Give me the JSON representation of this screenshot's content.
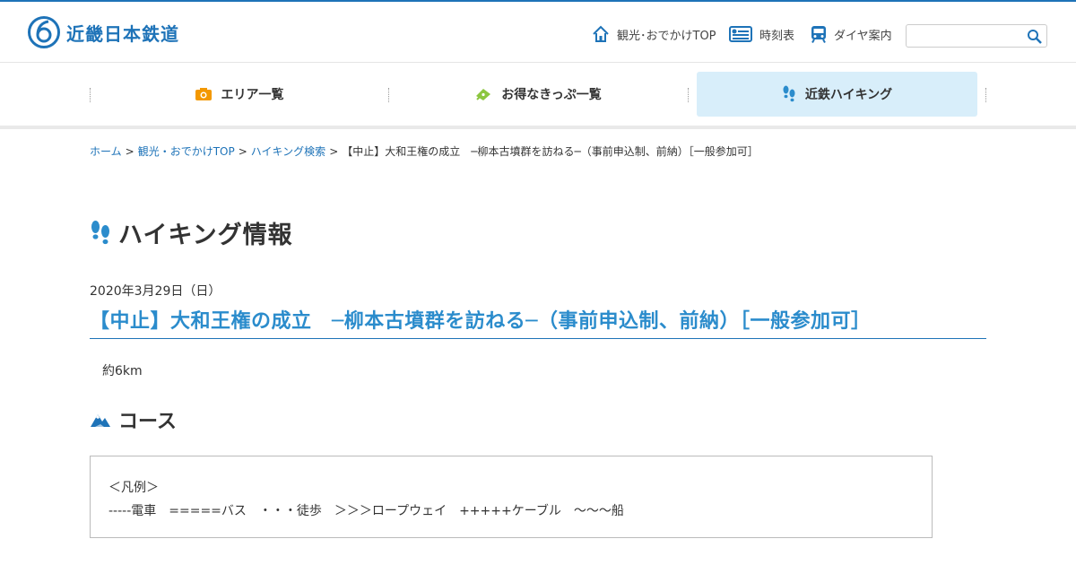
{
  "brand": {
    "name": "近畿日本鉄道",
    "color": "#1e73b8"
  },
  "header_links": [
    {
      "label": "観光･おでかけTOP",
      "icon": "home-icon"
    },
    {
      "label": "時刻表",
      "icon": "timetable-icon"
    },
    {
      "label": "ダイヤ案内",
      "icon": "train-icon"
    }
  ],
  "search": {
    "value": "",
    "placeholder": "",
    "icon": "search-icon"
  },
  "nav": [
    {
      "label": "エリア一覧",
      "icon": "camera-icon",
      "color": "#f39800"
    },
    {
      "label": "お得なきっぷ一覧",
      "icon": "ticket-icon",
      "color": "#8cc63f"
    },
    {
      "label": "近鉄ハイキング",
      "icon": "footprints-icon",
      "color": "#2b8ccc",
      "active": true
    }
  ],
  "breadcrumb": [
    "ホーム",
    "観光・おでかけTOP",
    "ハイキング検索",
    "【中止】大和王権の成立　─柳本古墳群を訪ねる─（事前申込制、前納）［一般参加可］"
  ],
  "page_title": "ハイキング情報",
  "event": {
    "date": "2020年3月29日（日）",
    "title": "【中止】大和王権の成立　─柳本古墳群を訪ねる─（事前申込制、前納）［一般参加可］",
    "distance": "約6km"
  },
  "course": {
    "heading": "コース",
    "legend_title": "＜凡例＞",
    "legend_line": "-----電車　=====バス　・・・徒歩　＞＞＞ロープウェイ　+++++ケーブル　〜〜〜船"
  }
}
